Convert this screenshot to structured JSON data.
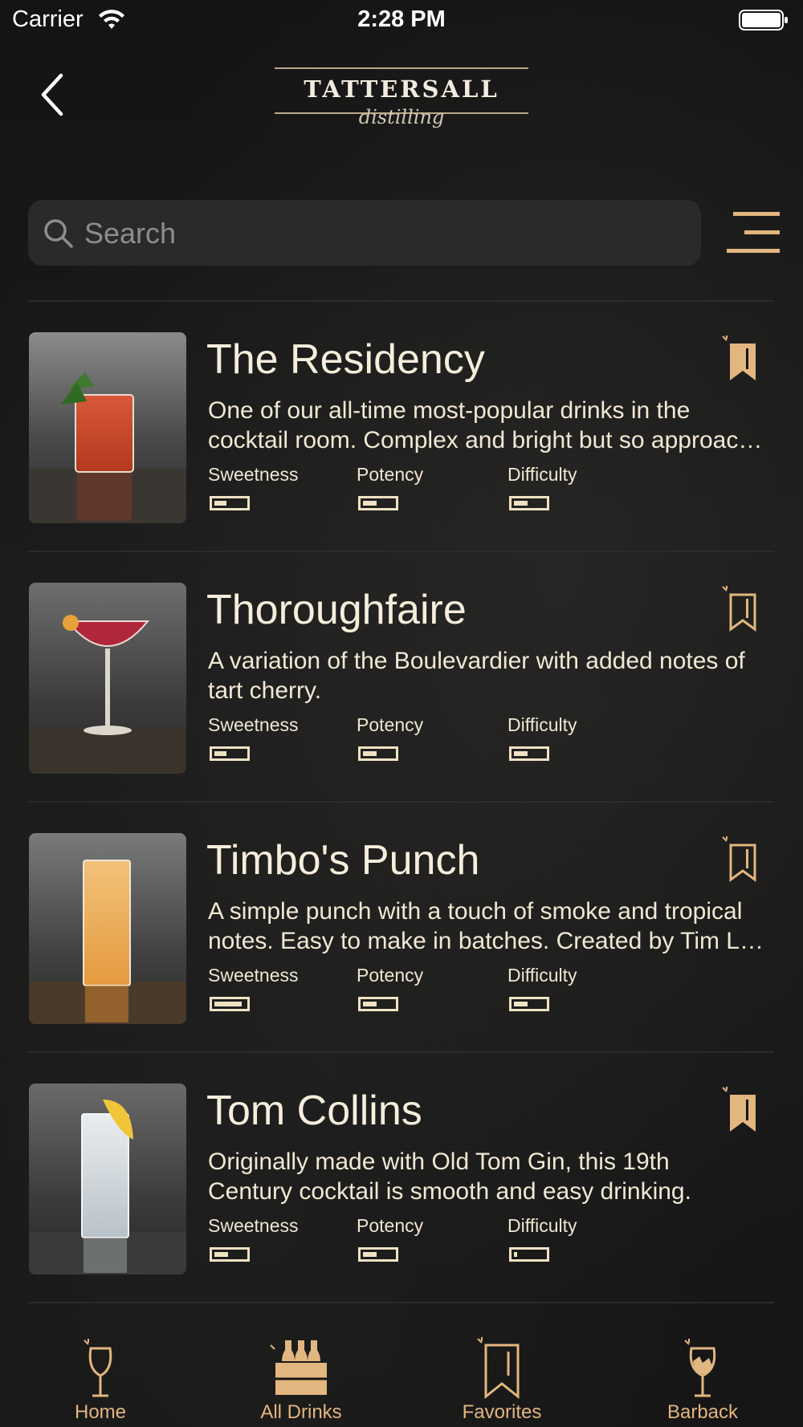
{
  "status_bar": {
    "carrier": "Carrier",
    "time": "2:28 PM"
  },
  "brand": {
    "name": "TATTERSALL",
    "tagline": "distilling"
  },
  "colors": {
    "accent": "#e2b67f",
    "text": "#f3ead7",
    "background": "#151515",
    "search_bg": "#2a2a2a",
    "meter": "#efe2c3"
  },
  "search": {
    "placeholder": "Search",
    "value": ""
  },
  "metric_labels": {
    "sweetness": "Sweetness",
    "potency": "Potency",
    "difficulty": "Difficulty"
  },
  "drinks": [
    {
      "name": "The Residency",
      "desc_lines": [
        "One of our all-time most-popular drinks in the",
        "cocktail room. Complex and bright but so approac…"
      ],
      "bookmarked": true,
      "sweetness": 0.4,
      "potency": 0.45,
      "difficulty": 0.45
    },
    {
      "name": "Thoroughfaire",
      "desc_lines": [
        "A variation of the Boulevardier with added notes of",
        "tart cherry."
      ],
      "bookmarked": false,
      "sweetness": 0.4,
      "potency": 0.45,
      "difficulty": 0.45
    },
    {
      "name": "Timbo's Punch",
      "desc_lines": [
        "A simple punch with a touch of smoke and tropical",
        "notes.  Easy to make in batches.  Created by Tim L…"
      ],
      "bookmarked": false,
      "sweetness": 0.9,
      "potency": 0.45,
      "difficulty": 0.45
    },
    {
      "name": "Tom Collins",
      "desc_lines": [
        "Originally made with Old Tom Gin, this 19th",
        "Century cocktail is smooth and easy drinking."
      ],
      "bookmarked": true,
      "sweetness": 0.45,
      "potency": 0.45,
      "difficulty": 0.1
    }
  ],
  "tabs": [
    {
      "label": "Home",
      "icon": "wine-glass-icon",
      "active": false
    },
    {
      "label": "All Drinks",
      "icon": "bottle-crate-icon",
      "active": true
    },
    {
      "label": "Favorites",
      "icon": "bookmark-icon",
      "active": false
    },
    {
      "label": "Barback",
      "icon": "broken-glass-icon",
      "active": false
    }
  ]
}
